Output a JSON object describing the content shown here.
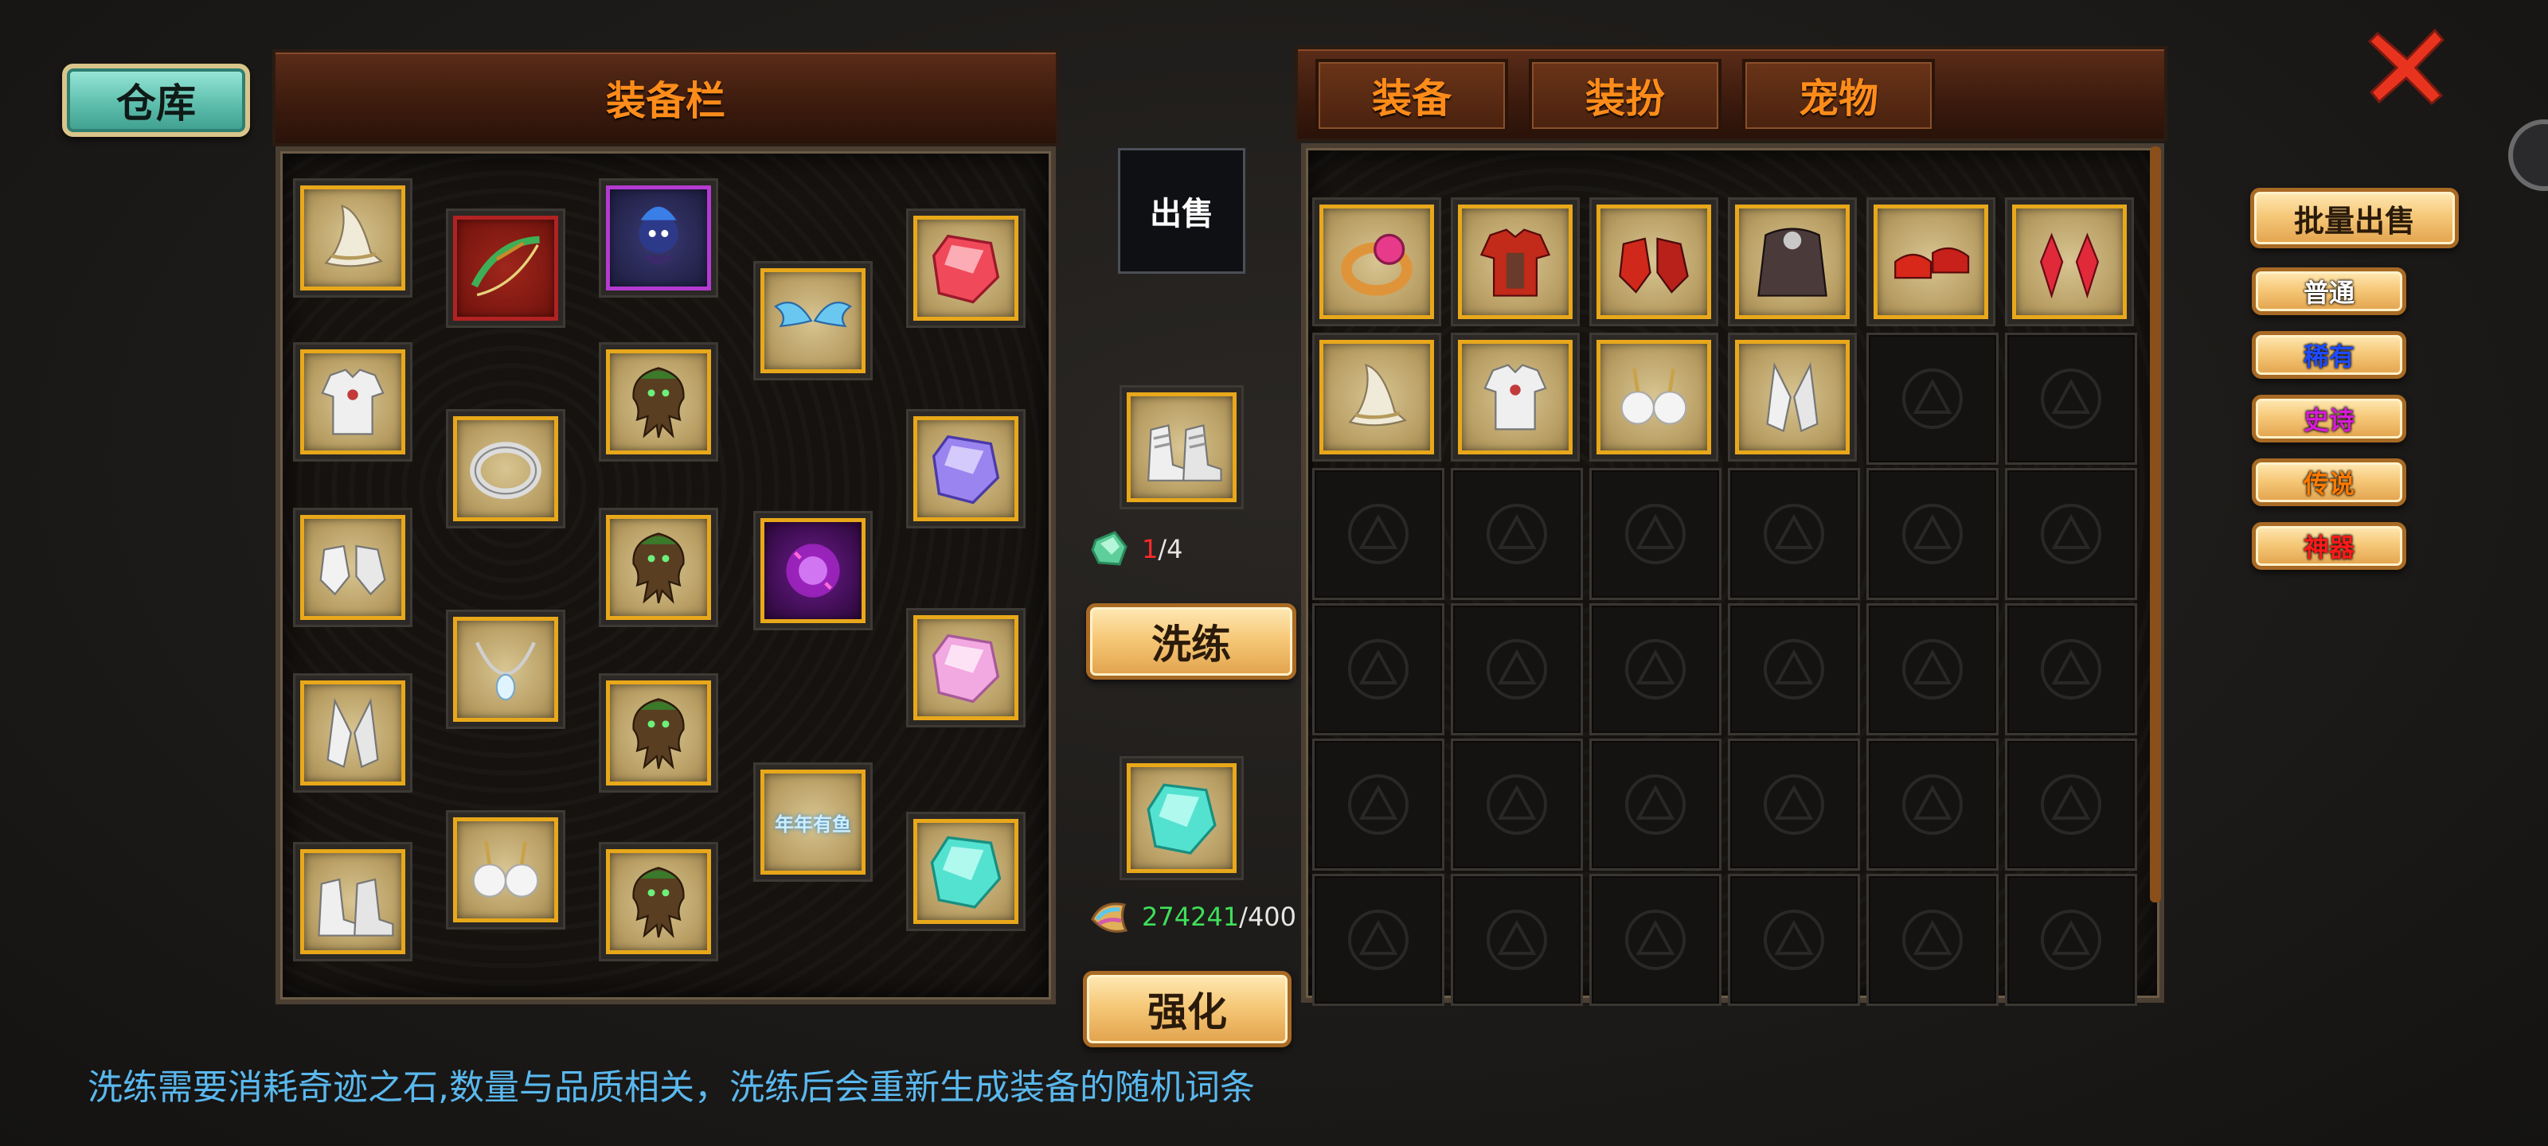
{
  "warehouse_button": "仓库",
  "equip_panel": {
    "title": "装备栏"
  },
  "inventory_tabs": [
    "装备",
    "装扮",
    "宠物"
  ],
  "sell_button": "出售",
  "refine": {
    "stone_have": "1",
    "stone_need": "/4",
    "button": "洗练"
  },
  "enhance": {
    "material_have": "274241",
    "material_need": "/400",
    "button": "强化"
  },
  "batch_sell_button": "批量出售",
  "quality_filters": [
    {
      "label": "普通",
      "color": "#ffffff"
    },
    {
      "label": "稀有",
      "color": "#1e4bff"
    },
    {
      "label": "史诗",
      "color": "#d51bd8"
    },
    {
      "label": "传说",
      "color": "#ff7a00"
    },
    {
      "label": "神器",
      "color": "#ff1a1a"
    }
  ],
  "footer_note": "洗练需要消耗奇迹之石,数量与品质相关，洗练后会重新生成装备的随机词条",
  "equipped_items": [
    "wizard-hat-icon",
    "bow-icon",
    "spirit-pet-icon",
    "red-gem-icon",
    "white-armor-icon",
    "silver-ring-icon",
    "tree-spirit-icon",
    "wings-icon",
    "purple-gem-icon",
    "white-gloves-icon",
    "tree-spirit-icon",
    "magic-orb-icon",
    "pink-gem-icon",
    "white-greaves-icon",
    "pearl-necklace-icon",
    "tree-spirit-icon",
    "white-boots-icon",
    "pearl-earrings-icon",
    "tree-spirit-icon",
    "title-badge-icon",
    "cyan-gem-icon"
  ],
  "title_badge_text": "年年有鱼",
  "inventory_items": [
    "gold-ring-icon",
    "red-armor-icon",
    "red-gauntlets-icon",
    "dark-cloak-icon",
    "red-shoes-icon",
    "ruby-earrings-icon",
    "wizard-hat-icon",
    "white-armor-icon",
    "pearl-earrings-icon",
    "white-greaves-icon"
  ]
}
